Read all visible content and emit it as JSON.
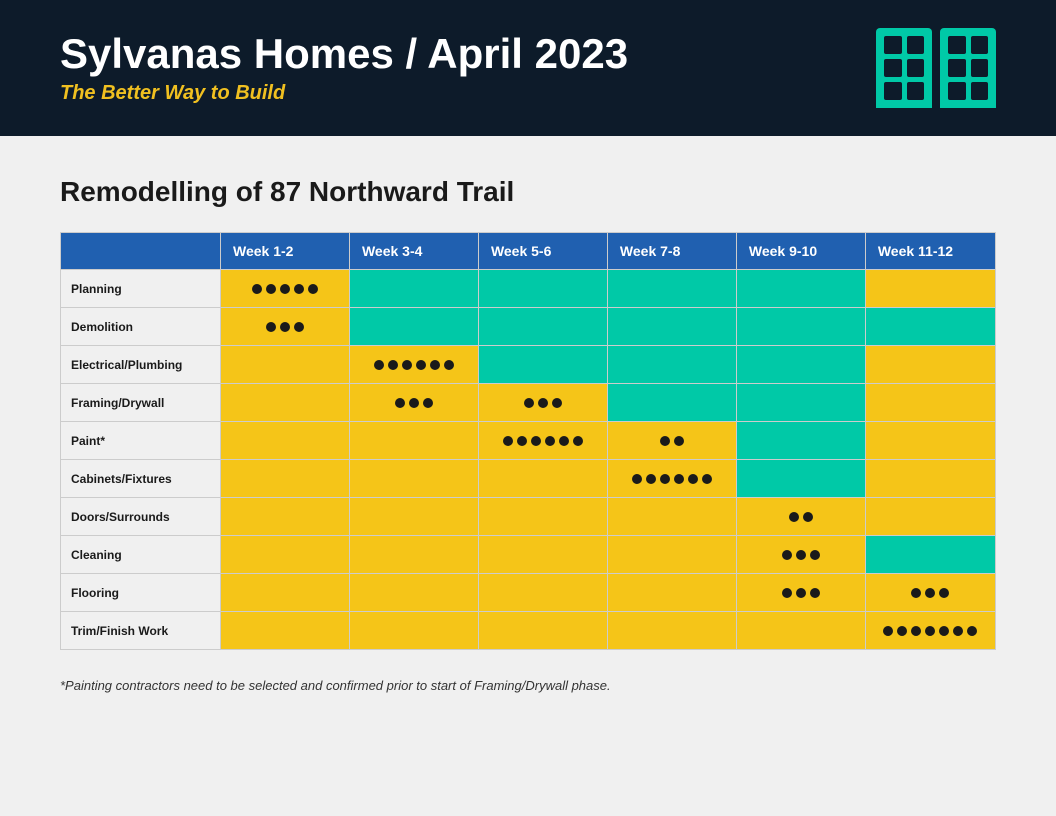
{
  "header": {
    "title": "Sylvanas Homes / April 2023",
    "tagline": "The Better Way to Build"
  },
  "section": {
    "title": "Remodelling of 87 Northward Trail"
  },
  "table": {
    "columns": [
      "",
      "Week 1-2",
      "Week 3-4",
      "Week 5-6",
      "Week 7-8",
      "Week 9-10",
      "Week 11-12"
    ],
    "rows": [
      {
        "task": "Planning",
        "cells": [
          "dots-5",
          "teal",
          "teal",
          "teal",
          "teal",
          "yellow"
        ],
        "dots": [
          5,
          0,
          0,
          0,
          0,
          0
        ]
      },
      {
        "task": "Demolition",
        "cells": [
          "dots-3",
          "teal",
          "teal",
          "teal",
          "teal",
          "teal"
        ],
        "dots": [
          3,
          0,
          0,
          0,
          0,
          0
        ]
      },
      {
        "task": "Electrical/Plumbing",
        "cells": [
          "yellow",
          "dots-6",
          "teal",
          "teal",
          "teal",
          "yellow"
        ],
        "dots": [
          0,
          6,
          0,
          0,
          0,
          0
        ]
      },
      {
        "task": "Framing/Drywall",
        "cells": [
          "yellow",
          "dots-3-3",
          "teal",
          "teal",
          "teal",
          "yellow"
        ],
        "dots": [
          0,
          "3-3",
          0,
          0,
          0,
          0
        ]
      },
      {
        "task": "Paint*",
        "cells": [
          "yellow",
          "yellow",
          "dots-8",
          "teal",
          "teal",
          "yellow"
        ],
        "dots": [
          0,
          0,
          8,
          0,
          0,
          0
        ]
      },
      {
        "task": "Cabinets/Fixtures",
        "cells": [
          "yellow",
          "yellow",
          "yellow",
          "dots-6",
          "teal",
          "yellow"
        ],
        "dots": [
          0,
          0,
          0,
          6,
          0,
          0
        ]
      },
      {
        "task": "Doors/Surrounds",
        "cells": [
          "yellow",
          "yellow",
          "yellow",
          "yellow",
          "dots-2",
          "yellow"
        ],
        "dots": [
          0,
          0,
          0,
          0,
          2,
          0
        ]
      },
      {
        "task": "Cleaning",
        "cells": [
          "yellow",
          "yellow",
          "yellow",
          "yellow",
          "dots-3",
          "teal"
        ],
        "dots": [
          0,
          0,
          0,
          0,
          3,
          0
        ]
      },
      {
        "task": "Flooring",
        "cells": [
          "yellow",
          "yellow",
          "yellow",
          "yellow",
          "dots-3-3",
          "yellow"
        ],
        "dots": [
          0,
          0,
          0,
          0,
          "3-3",
          0
        ]
      },
      {
        "task": "Trim/Finish Work",
        "cells": [
          "yellow",
          "yellow",
          "yellow",
          "yellow",
          "yellow",
          "dots-7"
        ],
        "dots": [
          0,
          0,
          0,
          0,
          0,
          7
        ]
      }
    ]
  },
  "footnote": "*Painting contractors need to be selected and confirmed prior to start of Framing/Drywall phase."
}
